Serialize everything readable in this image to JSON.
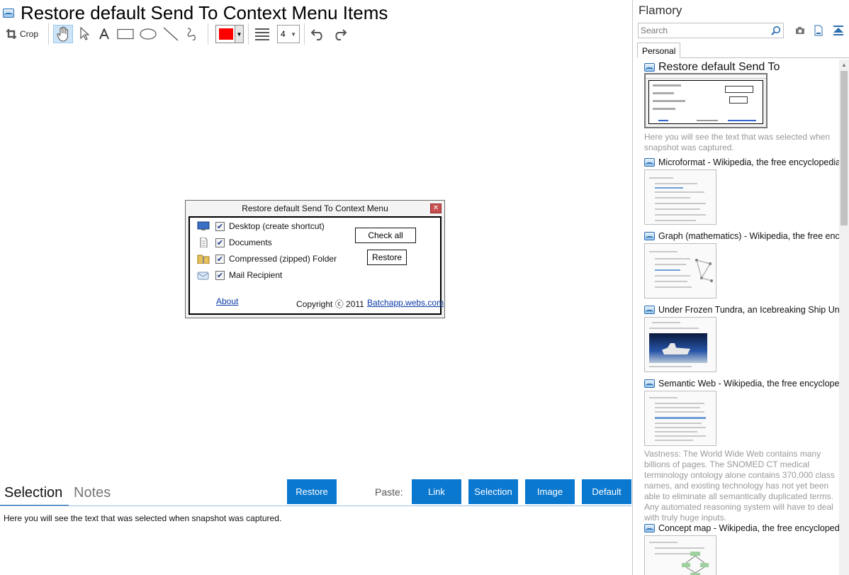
{
  "page": {
    "title": "Restore default Send To Context Menu Items"
  },
  "toolbar": {
    "crop_label": "Crop",
    "color": "#ff0000",
    "line_width": "4",
    "icons": [
      "crop-icon",
      "hand-icon",
      "pointer-icon",
      "text-icon",
      "rectangle-icon",
      "ellipse-icon",
      "line-icon",
      "freehand-icon",
      "line-width-icon",
      "undo-icon",
      "redo-icon"
    ]
  },
  "dialog": {
    "title": "Restore default Send To Context Menu",
    "close_glyph": "✕",
    "items": [
      {
        "label": "Desktop (create shortcut)",
        "checked": true,
        "icon": "desktop-icon"
      },
      {
        "label": "Documents",
        "checked": true,
        "icon": "document-icon"
      },
      {
        "label": "Compressed (zipped) Folder",
        "checked": true,
        "icon": "zip-folder-icon"
      },
      {
        "label": "Mail Recipient",
        "checked": true,
        "icon": "mail-icon"
      }
    ],
    "check_all": "Check all",
    "restore": "Restore",
    "about": "About",
    "copyright": "Copyright ⓒ 2011",
    "website": "Batchapp.webs.com"
  },
  "bottom": {
    "tabs": [
      "Selection",
      "Notes"
    ],
    "restore_button": "Restore",
    "paste_label": "Paste:",
    "paste_buttons": [
      "Link",
      "Selection",
      "Image",
      "Default"
    ],
    "selection_text": "Here you will see the text that was selected when snapshot was captured."
  },
  "sidebar": {
    "title": "Flamory",
    "search_placeholder": "Search",
    "tab": "Personal",
    "entries": [
      {
        "title": "Restore default Send To",
        "desc": "Here you will see the text that was selected when snapshot was captured."
      },
      {
        "title": "Microformat - Wikipedia, the free encyclopedia"
      },
      {
        "title": "Graph (mathematics) - Wikipedia, the free encyclopedia"
      },
      {
        "title": "Under Frozen Tundra, an Icebreaking Ship Uncovers"
      },
      {
        "title": "Semantic Web - Wikipedia, the free encyclopedia",
        "desc": "Vastness: The World Wide Web contains many billions of pages. The SNOMED CT medical terminology ontology alone contains 370,000 class names, and existing technology has not yet been able to eliminate all semantically duplicated terms. Any automated reasoning system will have to deal with truly huge inputs."
      },
      {
        "title": "Concept map - Wikipedia, the free encyclopedia"
      }
    ]
  },
  "colors": {
    "accent": "#0b78cf",
    "tab_underline": "#2a6db0"
  }
}
